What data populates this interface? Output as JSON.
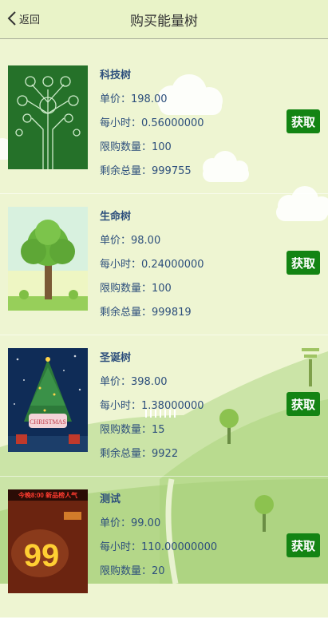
{
  "header": {
    "back_label": "返回",
    "title": "购买能量树"
  },
  "buttons": {
    "get_label": "获取"
  },
  "trees": [
    {
      "name": "科技树",
      "price": "单价：198.00",
      "hourly": "每小时：0.56000000",
      "limit": "限购数量：100",
      "remaining": "剩余总量：999755"
    },
    {
      "name": "生命树",
      "price": "单价：98.00",
      "hourly": "每小时：0.24000000",
      "limit": "限购数量：100",
      "remaining": "剩余总量：999819"
    },
    {
      "name": "圣诞树",
      "price": "单价：398.00",
      "hourly": "每小时：1.38000000",
      "limit": "限购数量：15",
      "remaining": "剩余总量：9922",
      "image_text": "CHRISTMAS"
    },
    {
      "name": "测试",
      "price": "单价：99.00",
      "hourly": "每小时：110.00000000",
      "limit": "限购数量：20",
      "image_text_top": "今晚8:00 新品榜人气",
      "image_text_big": "99"
    }
  ],
  "colors": {
    "button": "#138413",
    "text": "#2d4f7c",
    "header_bg": "#e9f3c8",
    "page_bg": "#eef5d2"
  }
}
